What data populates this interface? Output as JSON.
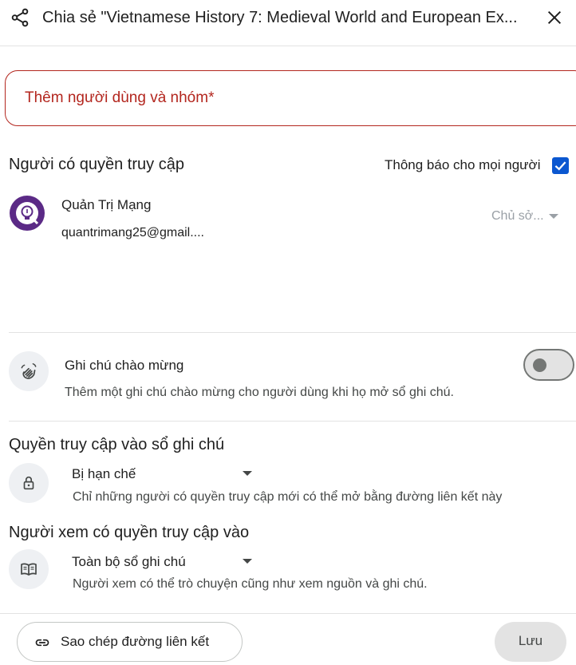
{
  "header": {
    "title": "Chia sẻ \"Vietnamese History 7: Medieval World and European Ex...",
    "share_icon": "share-icon",
    "close_icon": "close-icon"
  },
  "add_people": {
    "placeholder": "Thêm người dùng và nhóm*"
  },
  "access_section": {
    "title": "Người có quyền truy cập",
    "notify_label": "Thông báo cho mọi người",
    "notify_checked": true
  },
  "users": [
    {
      "name": "Quản Trị Mạng",
      "email": "quantrimang25@gmail....",
      "role": "Chủ sở..."
    }
  ],
  "welcome_note": {
    "title": "Ghi chú chào mừng",
    "description": "Thêm một ghi chú chào mừng cho người dùng khi họ mở sổ ghi chú.",
    "enabled": false,
    "icon": "waving-hand-icon"
  },
  "notebook_access": {
    "title": "Quyền truy cập vào sổ ghi chú",
    "selected": "Bị hạn chế",
    "description": "Chỉ những người có quyền truy cập mới có thể mở bằng đường liên kết này",
    "icon": "lock-icon"
  },
  "viewer_access": {
    "title": "Người xem có quyền truy cập vào",
    "selected": "Toàn bộ sổ ghi chú",
    "description": "Người xem có thể trò chuyện cũng như xem nguồn và ghi chú.",
    "icon": "book-icon"
  },
  "footer": {
    "copy_link_label": "Sao chép đường liên kết",
    "save_label": "Lưu"
  },
  "colors": {
    "error": "#b3261e",
    "accent": "#0b57d0",
    "avatar": "#5b2a86"
  }
}
